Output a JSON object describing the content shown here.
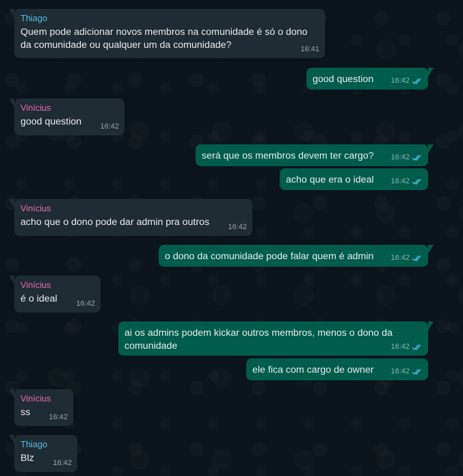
{
  "colors": {
    "background": "#0b141a",
    "incoming_bubble": "#202c33",
    "outgoing_bubble": "#005c4b",
    "text": "#e9edef",
    "read_ticks": "#53bdeb",
    "sender_thiago": "#53bdeb",
    "sender_vinicius": "#e26ab6"
  },
  "messages": [
    {
      "direction": "in",
      "sender": "Thiago",
      "text": "Quem pode adicionar novos membros na comunidade é só o dono\nda comunidade ou qualquer um da comunidade?",
      "time": "16:41"
    },
    {
      "direction": "out",
      "text": "good question",
      "time": "16:42",
      "status_icon": "double-check-read-icon"
    },
    {
      "direction": "in",
      "sender": "Vinícius",
      "text": "good question",
      "time": "16:42"
    },
    {
      "direction": "out",
      "text": "será que os membros devem ter cargo?",
      "time": "16:42",
      "status_icon": "double-check-read-icon"
    },
    {
      "direction": "out",
      "text": "acho que era o ideal",
      "time": "16:42",
      "status_icon": "double-check-read-icon"
    },
    {
      "direction": "in",
      "sender": "Vinícius",
      "text": "acho que o dono pode dar admin pra outros",
      "time": "16:42"
    },
    {
      "direction": "out",
      "text": "o dono da comunidade pode falar quem é admin",
      "time": "16:42",
      "status_icon": "double-check-read-icon"
    },
    {
      "direction": "in",
      "sender": "Vinícius",
      "text": "é o ideal",
      "time": "16:42"
    },
    {
      "direction": "out",
      "text": "ai os admins podem kickar outros membros, menos o dono da\ncomunidade",
      "time": "16:42",
      "status_icon": "double-check-read-icon"
    },
    {
      "direction": "out",
      "text": "ele fica com cargo de owner",
      "time": "16:42",
      "status_icon": "double-check-read-icon"
    },
    {
      "direction": "in",
      "sender": "Vinícius",
      "text": "ss",
      "time": "16:42"
    },
    {
      "direction": "in",
      "sender": "Thiago",
      "text": "Blz",
      "time": "16:42"
    }
  ]
}
